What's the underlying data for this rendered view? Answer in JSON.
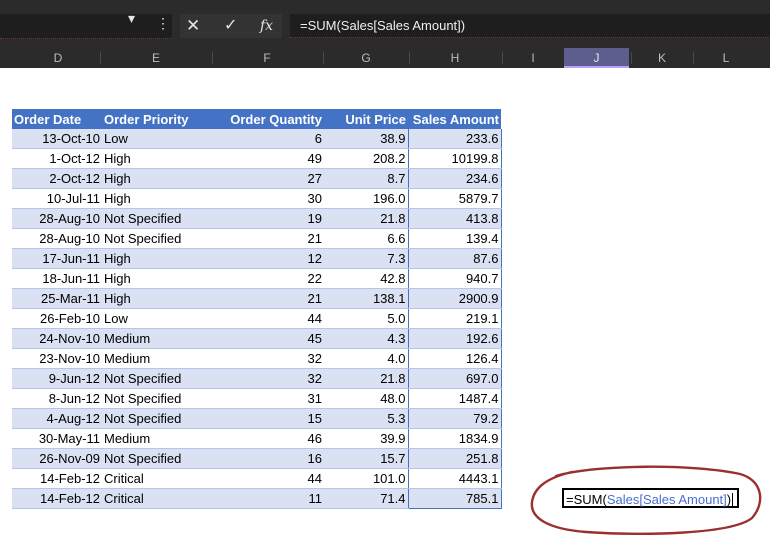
{
  "formula_bar": {
    "name_box_arrow": "▾",
    "more_icon": "⋮",
    "cancel_icon": "✕",
    "enter_icon": "✓",
    "fx_label": "fx",
    "formula": "=SUM(Sales[Sales Amount])"
  },
  "columns": [
    "D",
    "E",
    "F",
    "G",
    "H",
    "I",
    "J",
    "K",
    "L"
  ],
  "selected_column": "J",
  "table": {
    "headers": [
      "Order Date",
      "Order Priority",
      "Order Quantity",
      "Unit Price",
      "Sales Amount"
    ],
    "rows": [
      [
        "13-Oct-10",
        "Low",
        "6",
        "38.9",
        "233.6"
      ],
      [
        "1-Oct-12",
        "High",
        "49",
        "208.2",
        "10199.8"
      ],
      [
        "2-Oct-12",
        "High",
        "27",
        "8.7",
        "234.6"
      ],
      [
        "10-Jul-11",
        "High",
        "30",
        "196.0",
        "5879.7"
      ],
      [
        "28-Aug-10",
        "Not Specified",
        "19",
        "21.8",
        "413.8"
      ],
      [
        "28-Aug-10",
        "Not Specified",
        "21",
        "6.6",
        "139.4"
      ],
      [
        "17-Jun-11",
        "High",
        "12",
        "7.3",
        "87.6"
      ],
      [
        "18-Jun-11",
        "High",
        "22",
        "42.8",
        "940.7"
      ],
      [
        "25-Mar-11",
        "High",
        "21",
        "138.1",
        "2900.9"
      ],
      [
        "26-Feb-10",
        "Low",
        "44",
        "5.0",
        "219.1"
      ],
      [
        "24-Nov-10",
        "Medium",
        "45",
        "4.3",
        "192.6"
      ],
      [
        "23-Nov-10",
        "Medium",
        "32",
        "4.0",
        "126.4"
      ],
      [
        "9-Jun-12",
        "Not Specified",
        "32",
        "21.8",
        "697.0"
      ],
      [
        "8-Jun-12",
        "Not Specified",
        "31",
        "48.0",
        "1487.4"
      ],
      [
        "4-Aug-12",
        "Not Specified",
        "15",
        "5.3",
        "79.2"
      ],
      [
        "30-May-11",
        "Medium",
        "46",
        "39.9",
        "1834.9"
      ],
      [
        "26-Nov-09",
        "Not Specified",
        "16",
        "15.7",
        "251.8"
      ],
      [
        "14-Feb-12",
        "Critical",
        "44",
        "101.0",
        "4443.1"
      ],
      [
        "14-Feb-12",
        "Critical",
        "11",
        "71.4",
        "785.1"
      ]
    ]
  },
  "cell_editor": {
    "prefix": "=SUM(",
    "reference": "Sales[Sales Amount]",
    "suffix": ")"
  },
  "colors": {
    "header_blue": "#4472c4",
    "band_light": "#d9e1f2",
    "reference_blue": "#4a6fd0",
    "annotation_red": "#9b2f2f"
  }
}
